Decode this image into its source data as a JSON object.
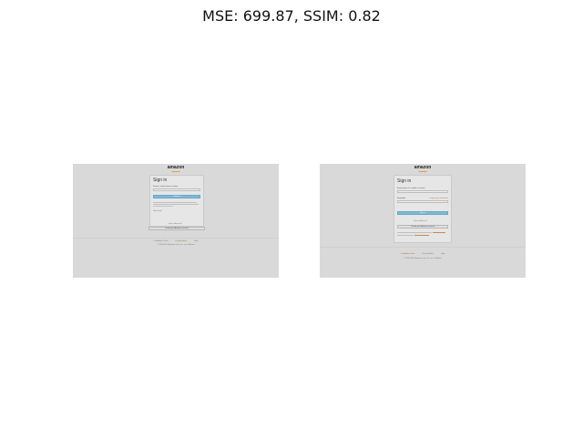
{
  "metrics": {
    "title": "MSE: 699.87, SSIM: 0.82"
  },
  "left_screen": {
    "logo": "amazon",
    "heading": "Sign in",
    "field_label": "Email or mobile phone number",
    "continue_label": "Continue",
    "need_help": "Need help?",
    "new_to_amazon": "New to Amazon?",
    "create_account_label": "Create your Amazon account",
    "footer_links": [
      "Conditions of Use",
      "Privacy Notice",
      "Help"
    ],
    "copyright": "© 1996-2023, Amazon.com, Inc. or its affiliates"
  },
  "right_screen": {
    "logo": "amazon",
    "heading": "Sign in",
    "email_label": "Email (phone for mobile accounts)",
    "password_label": "Password",
    "forgot_label": "Forgot your password?",
    "signin_label": "Sign in",
    "new_to_amazon": "New to Amazon?",
    "create_account_label": "Create your Amazon account",
    "footer_links": [
      "Conditions of Use",
      "Privacy Notice",
      "Help"
    ],
    "copyright": "© 1996-2023, Amazon.com, Inc. or its affiliates"
  }
}
